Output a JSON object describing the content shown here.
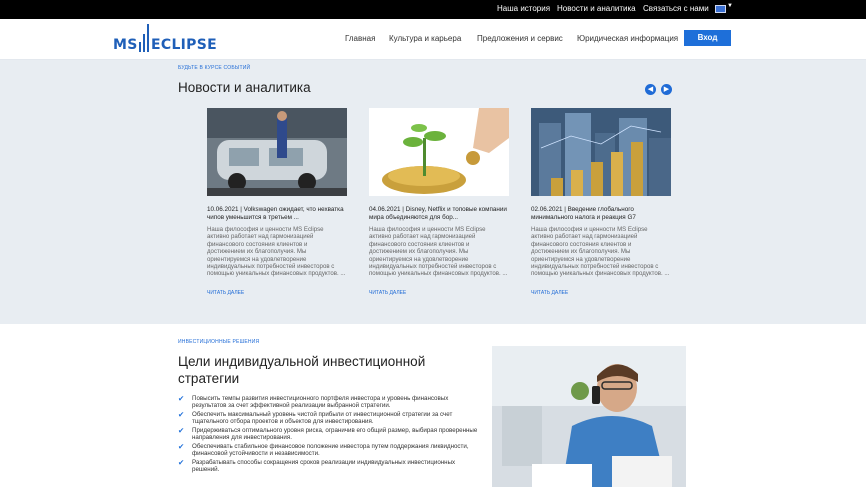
{
  "topbar": {
    "links": [
      "Наша история",
      "Новости и аналитика",
      "Связаться с нами"
    ],
    "language_icon": "flag-icon"
  },
  "header": {
    "logo": "MS ECLIPSE",
    "nav": [
      "Главная",
      "Культура и карьера",
      "Предложения и сервис",
      "Юридическая информация"
    ],
    "login": "Вход"
  },
  "news": {
    "kicker": "БУДЬТЕ В КУРСЕ СОБЫТИЙ",
    "title": "Новости и аналитика",
    "prev_icon": "chevron-left-icon",
    "next_icon": "chevron-right-icon",
    "cards": [
      {
        "title": "10.06.2021 | Volkswagen ожидает, что нехватка чипов уменьшится в третьем ...",
        "desc": "Наша философия и ценности MS Eclipse активно работает над гармонизацией финансового состояния клиентов и достижением их благополучия. Мы ориентируемся на удовлетворение индивидуальных потребностей инвесторов с помощью уникальных финансовых продуктов. ...",
        "more": "ЧИТАТЬ ДАЛЕЕ"
      },
      {
        "title": "04.06.2021 | Disney, Netflix и топовые компании мира объединяются для бор...",
        "desc": "Наша философия и ценности MS Eclipse активно работает над гармонизацией финансового состояния клиентов и достижением их благополучия. Мы ориентируемся на удовлетворение индивидуальных потребностей инвесторов с помощью уникальных финансовых продуктов. ...",
        "more": "ЧИТАТЬ ДАЛЕЕ"
      },
      {
        "title": "02.06.2021 | Введение глобального минимального налога и реакция G7",
        "desc": "Наша философия и ценности MS Eclipse активно работает над гармонизацией финансового состояния клиентов и достижением их благополучия. Мы ориентируемся на удовлетворение индивидуальных потребностей инвесторов с помощью уникальных финансовых продуктов. ...",
        "more": "ЧИТАТЬ ДАЛЕЕ"
      }
    ]
  },
  "invest": {
    "kicker": "ИНВЕСТИЦИОННЫЕ РЕШЕНИЯ",
    "title": "Цели индивидуальной инвестиционной стратегии",
    "items": [
      "Повысить темпы развития инвестиционного портфеля инвестора и уровень финансовых результатов за счет эффективной реализации выбранной стратегии.",
      "Обеспечить максимальный уровень чистой прибыли от инвестиционной стратегии за счет тщательного отбора проектов и объектов для инвестирования.",
      "Придерживаться оптимального уровня риска, ограничив его общий размер, выбирая проверенные направления для инвестирования.",
      "Обеспечивать стабильное финансовое положение инвестора путем поддержания ликвидности, финансовой устойчивости и независимости.",
      "Разрабатывать способы сокращения сроков реализации индивидуальных инвестиционных решений."
    ]
  }
}
